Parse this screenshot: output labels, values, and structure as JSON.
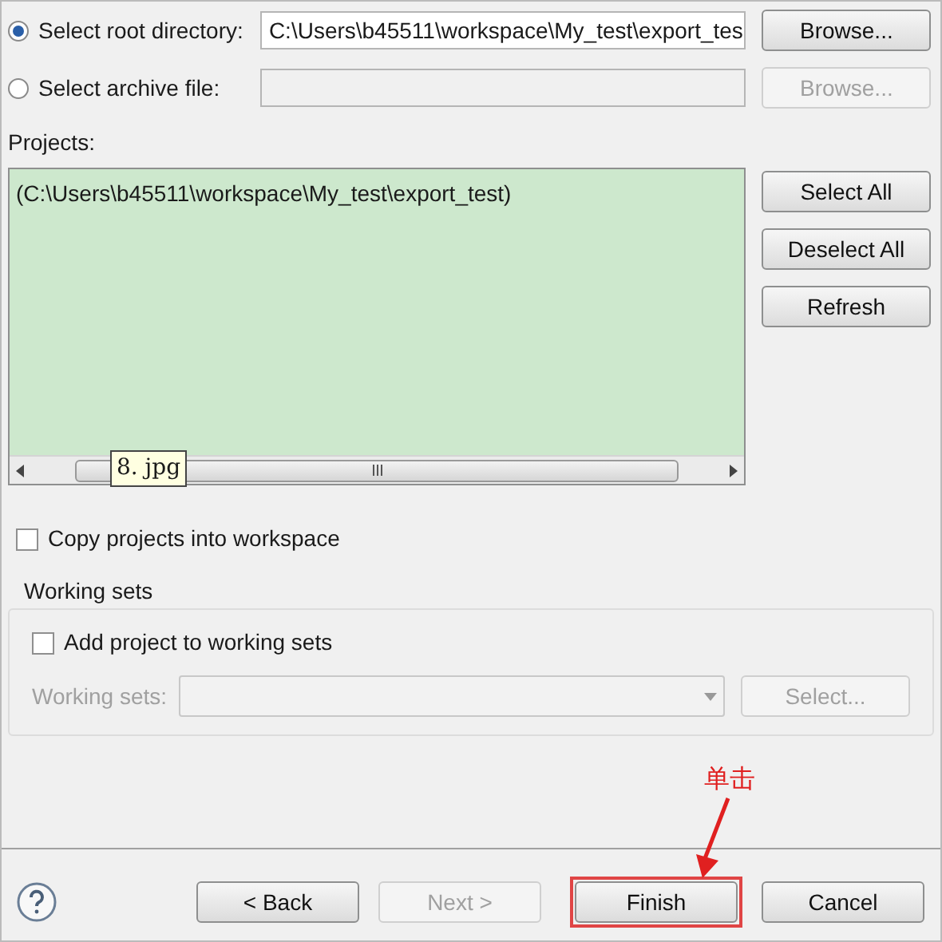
{
  "sources": [
    {
      "label": "Select root directory:",
      "selected": true,
      "value": "C:\\Users\\b45511\\workspace\\My_test\\export_tes",
      "button": "Browse...",
      "disabled": false
    },
    {
      "label": "Select archive file:",
      "selected": false,
      "button": "Browse...",
      "disabled": true
    }
  ],
  "projects": {
    "label": "Projects:",
    "items": [
      "(C:\\Users\\b45511\\workspace\\My_test\\export_test)"
    ],
    "tooltip": "8. jpg"
  },
  "project_buttons": [
    "Select All",
    "Deselect All",
    "Refresh"
  ],
  "copy_option": {
    "label": "Copy projects into workspace",
    "checked": false
  },
  "working_sets": {
    "title": "Working sets",
    "checkbox": {
      "label": "Add project to working sets",
      "checked": false
    },
    "field_label": "Working sets:",
    "button": "Select...",
    "disabled": true
  },
  "footer_buttons": [
    {
      "label": "< Back",
      "disabled": false,
      "highlighted": false
    },
    {
      "label": "Next >",
      "disabled": true,
      "highlighted": false
    },
    {
      "label": "Finish",
      "disabled": false,
      "highlighted": true
    },
    {
      "label": "Cancel",
      "disabled": false,
      "highlighted": false
    }
  ],
  "annotation": "单击"
}
